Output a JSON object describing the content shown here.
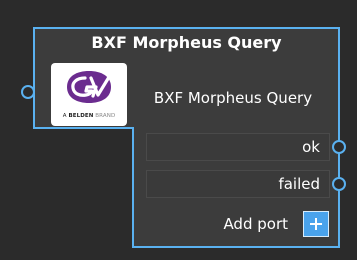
{
  "node": {
    "title": "BXF Morpheus Query",
    "label": "BXF Morpheus Query",
    "logo": {
      "icon": "grass-valley-logo",
      "tag_prefix": "A",
      "tag_brand": "BELDEN",
      "tag_suffix": "BRAND"
    },
    "outputs": [
      {
        "label": "ok"
      },
      {
        "label": "failed"
      }
    ],
    "add_port_label": "Add port"
  },
  "colors": {
    "background": "#2b2b2b",
    "node_fill": "#3c3c3c",
    "accent": "#5ab1f0",
    "port_box": "#3a3a3a",
    "logo_purple": "#6b2c8f"
  }
}
